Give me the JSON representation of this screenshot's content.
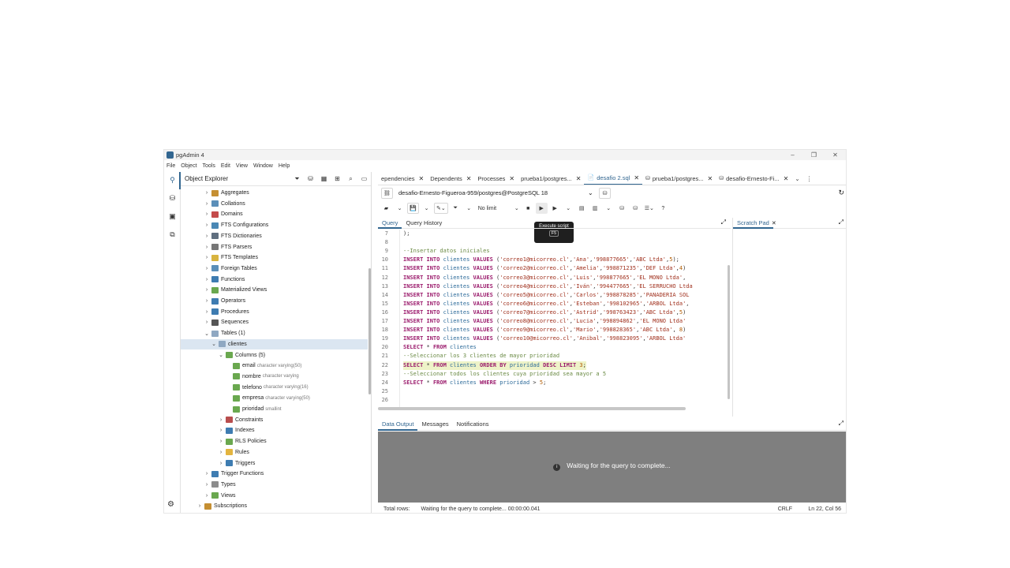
{
  "window": {
    "title": "pgAdmin 4",
    "minimize": "–",
    "restore": "❐",
    "close": "✕"
  },
  "menu": [
    "File",
    "Object",
    "Tools",
    "Edit",
    "View",
    "Window",
    "Help"
  ],
  "explorer": {
    "title": "Object Explorer",
    "tree": [
      {
        "label": "Aggregates",
        "level": 3,
        "arrow": "›",
        "icon": "aggregate-icon",
        "color": "#c58f32"
      },
      {
        "label": "Collations",
        "level": 3,
        "arrow": "›",
        "icon": "collation-icon",
        "color": "#5b8fb9"
      },
      {
        "label": "Domains",
        "level": 3,
        "arrow": "›",
        "icon": "domain-icon",
        "color": "#c44b4b"
      },
      {
        "label": "FTS Configurations",
        "level": 3,
        "arrow": "›",
        "icon": "fts-config-icon",
        "color": "#4a88b5"
      },
      {
        "label": "FTS Dictionaries",
        "level": 3,
        "arrow": "›",
        "icon": "fts-dict-icon",
        "color": "#5f6f7f"
      },
      {
        "label": "FTS Parsers",
        "level": 3,
        "arrow": "›",
        "icon": "fts-parser-icon",
        "color": "#777777"
      },
      {
        "label": "FTS Templates",
        "level": 3,
        "arrow": "›",
        "icon": "fts-template-icon",
        "color": "#d8b43f"
      },
      {
        "label": "Foreign Tables",
        "level": 3,
        "arrow": "›",
        "icon": "foreign-table-icon",
        "color": "#5b8fb9"
      },
      {
        "label": "Functions",
        "level": 3,
        "arrow": "›",
        "icon": "function-icon",
        "color": "#3e7cb1"
      },
      {
        "label": "Materialized Views",
        "level": 3,
        "arrow": "›",
        "icon": "mview-icon",
        "color": "#6aa84f"
      },
      {
        "label": "Operators",
        "level": 3,
        "arrow": "›",
        "icon": "operator-icon",
        "color": "#3e7cb1"
      },
      {
        "label": "Procedures",
        "level": 3,
        "arrow": "›",
        "icon": "procedure-icon",
        "color": "#3e7cb1"
      },
      {
        "label": "Sequences",
        "level": 3,
        "arrow": "›",
        "icon": "sequence-icon",
        "color": "#555555"
      },
      {
        "label": "Tables (1)",
        "level": 3,
        "arrow": "⌄",
        "icon": "tables-icon",
        "color": "#8fa8c2"
      },
      {
        "label": "clientes",
        "level": 4,
        "arrow": "⌄",
        "icon": "table-icon",
        "color": "#8fa8c2",
        "selected": true
      },
      {
        "label": "Columns (5)",
        "level": 5,
        "arrow": "⌄",
        "icon": "columns-icon",
        "color": "#6aa84f"
      },
      {
        "label": "email",
        "type": "character varying(50)",
        "level": 6,
        "arrow": "",
        "icon": "column-icon",
        "color": "#6aa84f"
      },
      {
        "label": "nombre",
        "type": "character varying",
        "level": 6,
        "arrow": "",
        "icon": "column-icon",
        "color": "#6aa84f"
      },
      {
        "label": "telefono",
        "type": "character varying(16)",
        "level": 6,
        "arrow": "",
        "icon": "column-icon",
        "color": "#6aa84f"
      },
      {
        "label": "empresa",
        "type": "character varying(50)",
        "level": 6,
        "arrow": "",
        "icon": "column-icon",
        "color": "#6aa84f"
      },
      {
        "label": "prioridad",
        "type": "smallint",
        "level": 6,
        "arrow": "",
        "icon": "column-icon",
        "color": "#6aa84f"
      },
      {
        "label": "Constraints",
        "level": 5,
        "arrow": "›",
        "icon": "constraint-icon",
        "color": "#b84d4d"
      },
      {
        "label": "Indexes",
        "level": 5,
        "arrow": "›",
        "icon": "index-icon",
        "color": "#3e7cb1"
      },
      {
        "label": "RLS Policies",
        "level": 5,
        "arrow": "›",
        "icon": "rls-icon",
        "color": "#6aa84f"
      },
      {
        "label": "Rules",
        "level": 5,
        "arrow": "›",
        "icon": "rule-icon",
        "color": "#e3b43f"
      },
      {
        "label": "Triggers",
        "level": 5,
        "arrow": "›",
        "icon": "trigger-icon",
        "color": "#3e7cb1"
      },
      {
        "label": "Trigger Functions",
        "level": 3,
        "arrow": "›",
        "icon": "trigger-function-icon",
        "color": "#3e7cb1"
      },
      {
        "label": "Types",
        "level": 3,
        "arrow": "›",
        "icon": "type-icon",
        "color": "#8c8c8c"
      },
      {
        "label": "Views",
        "level": 3,
        "arrow": "›",
        "icon": "view-icon",
        "color": "#6aa84f"
      },
      {
        "label": "Subscriptions",
        "level": 2,
        "arrow": "›",
        "icon": "subscription-icon",
        "color": "#c58f32"
      }
    ]
  },
  "tabs": [
    {
      "label": "ependencies",
      "icon": "",
      "active": false
    },
    {
      "label": "Dependents",
      "icon": "",
      "active": false
    },
    {
      "label": "Processes",
      "icon": "",
      "active": false
    },
    {
      "label": "prueba1/postgres...",
      "icon": "",
      "active": false
    },
    {
      "label": "desafio 2.sql",
      "icon": "📄",
      "active": true
    },
    {
      "label": "prueba1/postgres...",
      "icon": "⛁",
      "active": false
    },
    {
      "label": "desafio-Ernesto-Fi...",
      "icon": "⛁",
      "active": false
    }
  ],
  "connection": "desafio-Ernesto-Figueroa-959/postgres@PostgreSQL 18",
  "toolbar": {
    "limit": "No limit"
  },
  "tooltip": {
    "title": "Execute script",
    "key": "F5"
  },
  "query": {
    "tab_query": "Query",
    "tab_history": "Query History",
    "lines": [
      {
        "n": "7",
        "t": [
          {
            "c": "plain",
            "s": ");"
          }
        ]
      },
      {
        "n": "8",
        "t": []
      },
      {
        "n": "9",
        "t": [
          {
            "c": "cmt",
            "s": "--Insertar datos iniciales"
          }
        ]
      },
      {
        "n": "10",
        "t": [
          {
            "c": "kw",
            "s": "INSERT INTO "
          },
          {
            "c": "tbl",
            "s": "clientes "
          },
          {
            "c": "kw",
            "s": "VALUES "
          },
          {
            "c": "plain",
            "s": "("
          },
          {
            "c": "str",
            "s": "'correo1@micorreo.cl'"
          },
          {
            "c": "plain",
            "s": ","
          },
          {
            "c": "str",
            "s": "'Ana'"
          },
          {
            "c": "plain",
            "s": ","
          },
          {
            "c": "str",
            "s": "'998877665'"
          },
          {
            "c": "plain",
            "s": ","
          },
          {
            "c": "str",
            "s": "'ABC Ltda'"
          },
          {
            "c": "plain",
            "s": ","
          },
          {
            "c": "num",
            "s": "5"
          },
          {
            "c": "plain",
            "s": ");"
          }
        ]
      },
      {
        "n": "11",
        "t": [
          {
            "c": "kw",
            "s": "INSERT INTO "
          },
          {
            "c": "tbl",
            "s": "clientes "
          },
          {
            "c": "kw",
            "s": "VALUES "
          },
          {
            "c": "plain",
            "s": "("
          },
          {
            "c": "str",
            "s": "'correo2@micorreo.cl'"
          },
          {
            "c": "plain",
            "s": ","
          },
          {
            "c": "str",
            "s": "'Amelia'"
          },
          {
            "c": "plain",
            "s": ","
          },
          {
            "c": "str",
            "s": "'998871235'"
          },
          {
            "c": "plain",
            "s": ","
          },
          {
            "c": "str",
            "s": "'DEF Ltda'"
          },
          {
            "c": "plain",
            "s": ","
          },
          {
            "c": "num",
            "s": "4"
          },
          {
            "c": "plain",
            "s": ")"
          }
        ]
      },
      {
        "n": "12",
        "t": [
          {
            "c": "kw",
            "s": "INSERT INTO "
          },
          {
            "c": "tbl",
            "s": "clientes "
          },
          {
            "c": "kw",
            "s": "VALUES "
          },
          {
            "c": "plain",
            "s": "("
          },
          {
            "c": "str",
            "s": "'correo3@micorreo.cl'"
          },
          {
            "c": "plain",
            "s": ","
          },
          {
            "c": "str",
            "s": "'Luis'"
          },
          {
            "c": "plain",
            "s": ","
          },
          {
            "c": "str",
            "s": "'998877665'"
          },
          {
            "c": "plain",
            "s": ","
          },
          {
            "c": "str",
            "s": "'EL MONO Ltda'"
          },
          {
            "c": "plain",
            "s": ","
          }
        ]
      },
      {
        "n": "13",
        "t": [
          {
            "c": "kw",
            "s": "INSERT INTO "
          },
          {
            "c": "tbl",
            "s": "clientes "
          },
          {
            "c": "kw",
            "s": "VALUES "
          },
          {
            "c": "plain",
            "s": "("
          },
          {
            "c": "str",
            "s": "'correo4@micorreo.cl'"
          },
          {
            "c": "plain",
            "s": ","
          },
          {
            "c": "str",
            "s": "'Iván'"
          },
          {
            "c": "plain",
            "s": ","
          },
          {
            "c": "str",
            "s": "'994477665'"
          },
          {
            "c": "plain",
            "s": ","
          },
          {
            "c": "str",
            "s": "'EL SERRUCHO Ltda"
          }
        ]
      },
      {
        "n": "14",
        "t": [
          {
            "c": "kw",
            "s": "INSERT INTO "
          },
          {
            "c": "tbl",
            "s": "clientes "
          },
          {
            "c": "kw",
            "s": "VALUES "
          },
          {
            "c": "plain",
            "s": "("
          },
          {
            "c": "str",
            "s": "'correo5@micorreo.cl'"
          },
          {
            "c": "plain",
            "s": ","
          },
          {
            "c": "str",
            "s": "'Carlos'"
          },
          {
            "c": "plain",
            "s": ","
          },
          {
            "c": "str",
            "s": "'998878285'"
          },
          {
            "c": "plain",
            "s": ","
          },
          {
            "c": "str",
            "s": "'PANADERIA SOL"
          }
        ]
      },
      {
        "n": "15",
        "t": [
          {
            "c": "kw",
            "s": "INSERT INTO "
          },
          {
            "c": "tbl",
            "s": "clientes "
          },
          {
            "c": "kw",
            "s": "VALUES "
          },
          {
            "c": "plain",
            "s": "("
          },
          {
            "c": "str",
            "s": "'correo6@micorreo.cl'"
          },
          {
            "c": "plain",
            "s": ","
          },
          {
            "c": "str",
            "s": "'Esteban'"
          },
          {
            "c": "plain",
            "s": ","
          },
          {
            "c": "str",
            "s": "'998102965'"
          },
          {
            "c": "plain",
            "s": ","
          },
          {
            "c": "str",
            "s": "'ARBOL Ltda'"
          },
          {
            "c": "plain",
            "s": ","
          }
        ]
      },
      {
        "n": "16",
        "t": [
          {
            "c": "kw",
            "s": "INSERT INTO "
          },
          {
            "c": "tbl",
            "s": "clientes "
          },
          {
            "c": "kw",
            "s": "VALUES "
          },
          {
            "c": "plain",
            "s": "("
          },
          {
            "c": "str",
            "s": "'correo7@micorreo.cl'"
          },
          {
            "c": "plain",
            "s": ","
          },
          {
            "c": "str",
            "s": "'Astrid'"
          },
          {
            "c": "plain",
            "s": ","
          },
          {
            "c": "str",
            "s": "'998763423'"
          },
          {
            "c": "plain",
            "s": ","
          },
          {
            "c": "str",
            "s": "'ABC Ltda'"
          },
          {
            "c": "plain",
            "s": ","
          },
          {
            "c": "num",
            "s": "5"
          },
          {
            "c": "plain",
            "s": ")"
          }
        ]
      },
      {
        "n": "17",
        "t": [
          {
            "c": "kw",
            "s": "INSERT INTO "
          },
          {
            "c": "tbl",
            "s": "clientes "
          },
          {
            "c": "kw",
            "s": "VALUES "
          },
          {
            "c": "plain",
            "s": "("
          },
          {
            "c": "str",
            "s": "'correo8@micorreo.cl'"
          },
          {
            "c": "plain",
            "s": ","
          },
          {
            "c": "str",
            "s": "'Lucia'"
          },
          {
            "c": "plain",
            "s": ","
          },
          {
            "c": "str",
            "s": "'998894862'"
          },
          {
            "c": "plain",
            "s": ","
          },
          {
            "c": "str",
            "s": "'EL MONO Ltda'"
          }
        ]
      },
      {
        "n": "18",
        "t": [
          {
            "c": "kw",
            "s": "INSERT INTO "
          },
          {
            "c": "tbl",
            "s": "clientes "
          },
          {
            "c": "kw",
            "s": "VALUES "
          },
          {
            "c": "plain",
            "s": "("
          },
          {
            "c": "str",
            "s": "'correo9@micorreo.cl'"
          },
          {
            "c": "plain",
            "s": ","
          },
          {
            "c": "str",
            "s": "'Mario'"
          },
          {
            "c": "plain",
            "s": ","
          },
          {
            "c": "str",
            "s": "'998828365'"
          },
          {
            "c": "plain",
            "s": ","
          },
          {
            "c": "str",
            "s": "'ABC Ltda'"
          },
          {
            "c": "plain",
            "s": ", "
          },
          {
            "c": "num",
            "s": "8"
          },
          {
            "c": "plain",
            "s": ")"
          }
        ]
      },
      {
        "n": "19",
        "t": [
          {
            "c": "kw",
            "s": "INSERT INTO "
          },
          {
            "c": "tbl",
            "s": "clientes "
          },
          {
            "c": "kw",
            "s": "VALUES "
          },
          {
            "c": "plain",
            "s": "("
          },
          {
            "c": "str",
            "s": "'correo10@micorreo.cl'"
          },
          {
            "c": "plain",
            "s": ","
          },
          {
            "c": "str",
            "s": "'Anibal'"
          },
          {
            "c": "plain",
            "s": ","
          },
          {
            "c": "str",
            "s": "'998823095'"
          },
          {
            "c": "plain",
            "s": ","
          },
          {
            "c": "str",
            "s": "'ARBOL Ltda'"
          }
        ]
      },
      {
        "n": "20",
        "t": [
          {
            "c": "kw",
            "s": "SELECT "
          },
          {
            "c": "plain",
            "s": "* "
          },
          {
            "c": "kw",
            "s": "FROM "
          },
          {
            "c": "tbl",
            "s": "clientes"
          }
        ]
      },
      {
        "n": "21",
        "t": [
          {
            "c": "cmt",
            "s": "--Seleccionar los 3 clientes de mayor prioridad"
          }
        ]
      },
      {
        "n": "22",
        "hl": true,
        "t": [
          {
            "c": "kw",
            "s": "SELECT "
          },
          {
            "c": "plain",
            "s": "* "
          },
          {
            "c": "kw",
            "s": "FROM "
          },
          {
            "c": "tbl",
            "s": "clientes "
          },
          {
            "c": "kw",
            "s": "ORDER BY "
          },
          {
            "c": "tbl",
            "s": "prioridad "
          },
          {
            "c": "kw",
            "s": "DESC LIMIT "
          },
          {
            "c": "num",
            "s": "3"
          },
          {
            "c": "plain",
            "s": ";"
          }
        ]
      },
      {
        "n": "23",
        "t": [
          {
            "c": "cmt",
            "s": "--Seleccionar todos los clientes cuya prioridad sea mayor a 5"
          }
        ]
      },
      {
        "n": "24",
        "t": [
          {
            "c": "kw",
            "s": "SELECT "
          },
          {
            "c": "plain",
            "s": "* "
          },
          {
            "c": "kw",
            "s": "FROM "
          },
          {
            "c": "tbl",
            "s": "clientes "
          },
          {
            "c": "kw",
            "s": "WHERE "
          },
          {
            "c": "tbl",
            "s": "prioridad "
          },
          {
            "c": "plain",
            "s": "> "
          },
          {
            "c": "num",
            "s": "5"
          },
          {
            "c": "plain",
            "s": ";"
          }
        ]
      },
      {
        "n": "25",
        "t": []
      },
      {
        "n": "26",
        "t": []
      }
    ]
  },
  "scratch": {
    "label": "Scratch Pad"
  },
  "output": {
    "tab_data": "Data Output",
    "tab_messages": "Messages",
    "tab_notifications": "Notifications",
    "waiting": "Waiting for the query to complete..."
  },
  "status": {
    "total_rows_label": "Total rows:",
    "message": "Waiting for the query to complete... 00:00:00.041",
    "eol": "CRLF",
    "position": "Ln 22, Col 56"
  }
}
